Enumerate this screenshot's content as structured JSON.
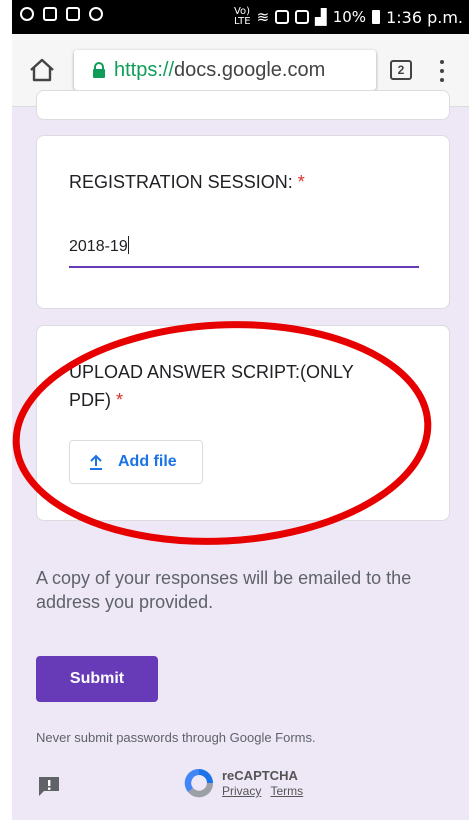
{
  "statusbar": {
    "network_label": "Vo)",
    "network_sub": "LTE",
    "battery": "10%",
    "time": "1:36 p.m."
  },
  "browser": {
    "url_scheme": "https://",
    "url_host": "docs.google.com",
    "tab_count": "2"
  },
  "form": {
    "session_question": "REGISTRATION SESSION:",
    "session_required": "*",
    "session_value": "2018-19",
    "upload_question_line1": "UPLOAD ANSWER SCRIPT:(ONLY",
    "upload_question_line2": "PDF)",
    "upload_required": "*",
    "add_file_label": "Add file",
    "notice": "A copy of your responses will be emailed to the address you provided.",
    "submit_label": "Submit",
    "password_warning": "Never submit passwords through Google Forms."
  },
  "recaptcha": {
    "name": "reCAPTCHA",
    "privacy": "Privacy",
    "terms": "Terms"
  },
  "colors": {
    "accent": "#673ab7",
    "required": "#d93025",
    "link": "#1a73e8",
    "background": "#ede7f6",
    "annotation": "#e60000"
  }
}
